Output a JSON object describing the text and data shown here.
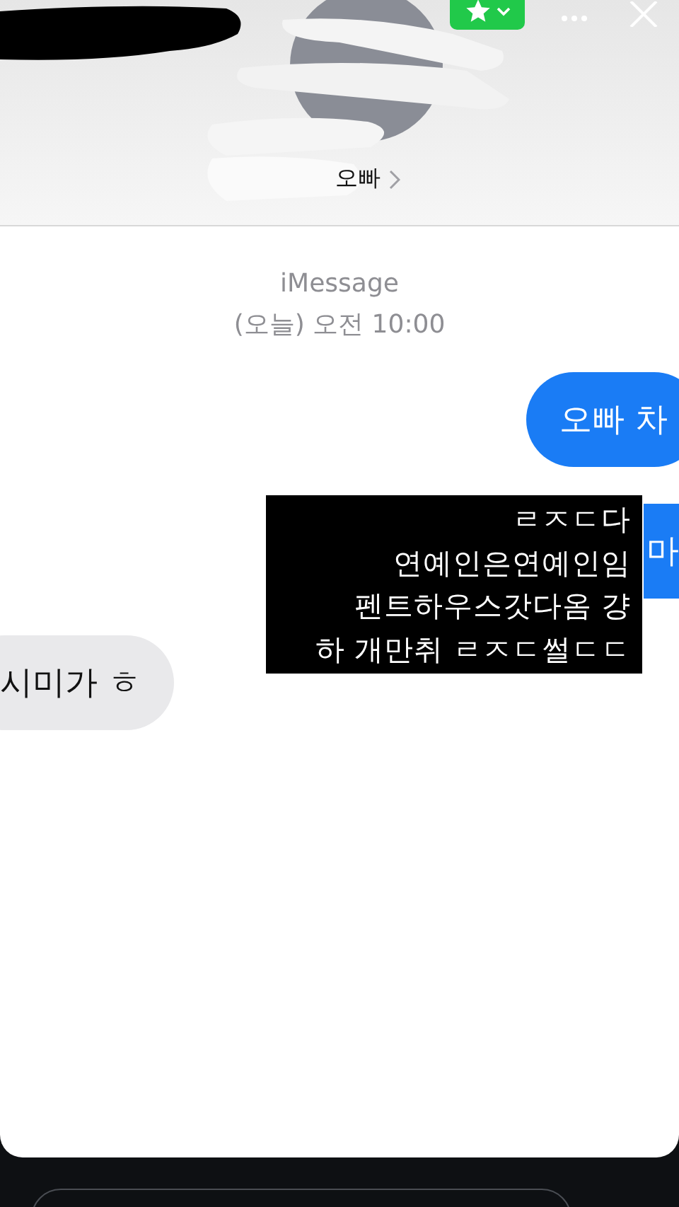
{
  "header": {
    "contact_name": "오빠"
  },
  "conversation": {
    "service": "iMessage",
    "timestamp": "(오늘) 오전 10:00",
    "messages": [
      {
        "kind": "sent",
        "text": "오빠 차"
      },
      {
        "kind": "sent",
        "text": "마"
      },
      {
        "kind": "received",
        "text": "시미가 ㅎ"
      }
    ]
  },
  "caption": {
    "lines": [
      "ㄹㅈㄷ다",
      "연예인은연예인임",
      "펜트하우스갓다옴 걍",
      "하  개만취 ㄹㅈㄷ썰ㄷㄷ"
    ]
  }
}
